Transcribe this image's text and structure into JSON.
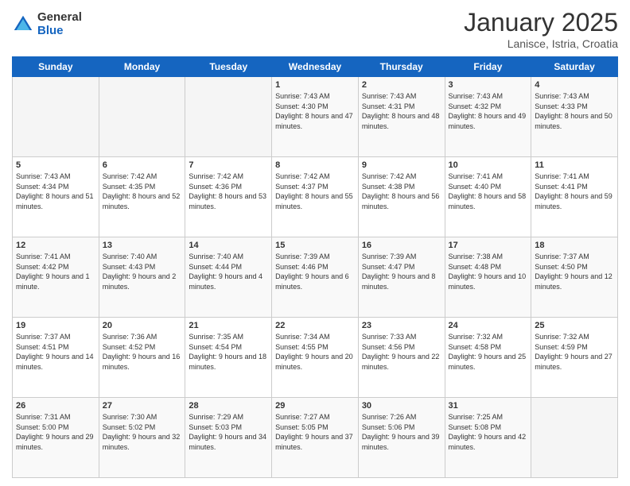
{
  "logo": {
    "general": "General",
    "blue": "Blue"
  },
  "title": "January 2025",
  "location": "Lanisce, Istria, Croatia",
  "days_of_week": [
    "Sunday",
    "Monday",
    "Tuesday",
    "Wednesday",
    "Thursday",
    "Friday",
    "Saturday"
  ],
  "weeks": [
    [
      {
        "day": "",
        "info": ""
      },
      {
        "day": "",
        "info": ""
      },
      {
        "day": "",
        "info": ""
      },
      {
        "day": "1",
        "info": "Sunrise: 7:43 AM\nSunset: 4:30 PM\nDaylight: 8 hours and 47 minutes."
      },
      {
        "day": "2",
        "info": "Sunrise: 7:43 AM\nSunset: 4:31 PM\nDaylight: 8 hours and 48 minutes."
      },
      {
        "day": "3",
        "info": "Sunrise: 7:43 AM\nSunset: 4:32 PM\nDaylight: 8 hours and 49 minutes."
      },
      {
        "day": "4",
        "info": "Sunrise: 7:43 AM\nSunset: 4:33 PM\nDaylight: 8 hours and 50 minutes."
      }
    ],
    [
      {
        "day": "5",
        "info": "Sunrise: 7:43 AM\nSunset: 4:34 PM\nDaylight: 8 hours and 51 minutes."
      },
      {
        "day": "6",
        "info": "Sunrise: 7:42 AM\nSunset: 4:35 PM\nDaylight: 8 hours and 52 minutes."
      },
      {
        "day": "7",
        "info": "Sunrise: 7:42 AM\nSunset: 4:36 PM\nDaylight: 8 hours and 53 minutes."
      },
      {
        "day": "8",
        "info": "Sunrise: 7:42 AM\nSunset: 4:37 PM\nDaylight: 8 hours and 55 minutes."
      },
      {
        "day": "9",
        "info": "Sunrise: 7:42 AM\nSunset: 4:38 PM\nDaylight: 8 hours and 56 minutes."
      },
      {
        "day": "10",
        "info": "Sunrise: 7:41 AM\nSunset: 4:40 PM\nDaylight: 8 hours and 58 minutes."
      },
      {
        "day": "11",
        "info": "Sunrise: 7:41 AM\nSunset: 4:41 PM\nDaylight: 8 hours and 59 minutes."
      }
    ],
    [
      {
        "day": "12",
        "info": "Sunrise: 7:41 AM\nSunset: 4:42 PM\nDaylight: 9 hours and 1 minute."
      },
      {
        "day": "13",
        "info": "Sunrise: 7:40 AM\nSunset: 4:43 PM\nDaylight: 9 hours and 2 minutes."
      },
      {
        "day": "14",
        "info": "Sunrise: 7:40 AM\nSunset: 4:44 PM\nDaylight: 9 hours and 4 minutes."
      },
      {
        "day": "15",
        "info": "Sunrise: 7:39 AM\nSunset: 4:46 PM\nDaylight: 9 hours and 6 minutes."
      },
      {
        "day": "16",
        "info": "Sunrise: 7:39 AM\nSunset: 4:47 PM\nDaylight: 9 hours and 8 minutes."
      },
      {
        "day": "17",
        "info": "Sunrise: 7:38 AM\nSunset: 4:48 PM\nDaylight: 9 hours and 10 minutes."
      },
      {
        "day": "18",
        "info": "Sunrise: 7:37 AM\nSunset: 4:50 PM\nDaylight: 9 hours and 12 minutes."
      }
    ],
    [
      {
        "day": "19",
        "info": "Sunrise: 7:37 AM\nSunset: 4:51 PM\nDaylight: 9 hours and 14 minutes."
      },
      {
        "day": "20",
        "info": "Sunrise: 7:36 AM\nSunset: 4:52 PM\nDaylight: 9 hours and 16 minutes."
      },
      {
        "day": "21",
        "info": "Sunrise: 7:35 AM\nSunset: 4:54 PM\nDaylight: 9 hours and 18 minutes."
      },
      {
        "day": "22",
        "info": "Sunrise: 7:34 AM\nSunset: 4:55 PM\nDaylight: 9 hours and 20 minutes."
      },
      {
        "day": "23",
        "info": "Sunrise: 7:33 AM\nSunset: 4:56 PM\nDaylight: 9 hours and 22 minutes."
      },
      {
        "day": "24",
        "info": "Sunrise: 7:32 AM\nSunset: 4:58 PM\nDaylight: 9 hours and 25 minutes."
      },
      {
        "day": "25",
        "info": "Sunrise: 7:32 AM\nSunset: 4:59 PM\nDaylight: 9 hours and 27 minutes."
      }
    ],
    [
      {
        "day": "26",
        "info": "Sunrise: 7:31 AM\nSunset: 5:00 PM\nDaylight: 9 hours and 29 minutes."
      },
      {
        "day": "27",
        "info": "Sunrise: 7:30 AM\nSunset: 5:02 PM\nDaylight: 9 hours and 32 minutes."
      },
      {
        "day": "28",
        "info": "Sunrise: 7:29 AM\nSunset: 5:03 PM\nDaylight: 9 hours and 34 minutes."
      },
      {
        "day": "29",
        "info": "Sunrise: 7:27 AM\nSunset: 5:05 PM\nDaylight: 9 hours and 37 minutes."
      },
      {
        "day": "30",
        "info": "Sunrise: 7:26 AM\nSunset: 5:06 PM\nDaylight: 9 hours and 39 minutes."
      },
      {
        "day": "31",
        "info": "Sunrise: 7:25 AM\nSunset: 5:08 PM\nDaylight: 9 hours and 42 minutes."
      },
      {
        "day": "",
        "info": ""
      }
    ]
  ]
}
